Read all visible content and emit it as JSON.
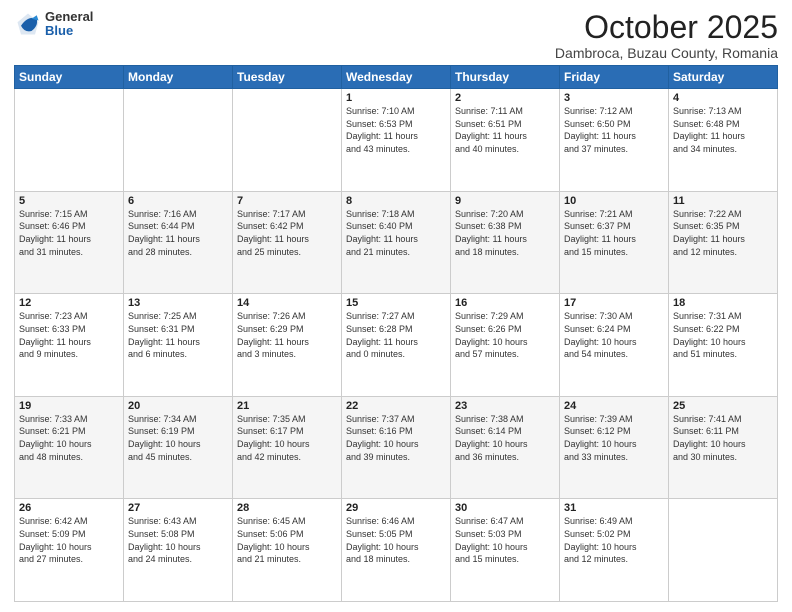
{
  "header": {
    "logo_general": "General",
    "logo_blue": "Blue",
    "title": "October 2025",
    "location": "Dambroca, Buzau County, Romania"
  },
  "weekdays": [
    "Sunday",
    "Monday",
    "Tuesday",
    "Wednesday",
    "Thursday",
    "Friday",
    "Saturday"
  ],
  "weeks": [
    [
      {
        "day": "",
        "info": ""
      },
      {
        "day": "",
        "info": ""
      },
      {
        "day": "",
        "info": ""
      },
      {
        "day": "1",
        "info": "Sunrise: 7:10 AM\nSunset: 6:53 PM\nDaylight: 11 hours\nand 43 minutes."
      },
      {
        "day": "2",
        "info": "Sunrise: 7:11 AM\nSunset: 6:51 PM\nDaylight: 11 hours\nand 40 minutes."
      },
      {
        "day": "3",
        "info": "Sunrise: 7:12 AM\nSunset: 6:50 PM\nDaylight: 11 hours\nand 37 minutes."
      },
      {
        "day": "4",
        "info": "Sunrise: 7:13 AM\nSunset: 6:48 PM\nDaylight: 11 hours\nand 34 minutes."
      }
    ],
    [
      {
        "day": "5",
        "info": "Sunrise: 7:15 AM\nSunset: 6:46 PM\nDaylight: 11 hours\nand 31 minutes."
      },
      {
        "day": "6",
        "info": "Sunrise: 7:16 AM\nSunset: 6:44 PM\nDaylight: 11 hours\nand 28 minutes."
      },
      {
        "day": "7",
        "info": "Sunrise: 7:17 AM\nSunset: 6:42 PM\nDaylight: 11 hours\nand 25 minutes."
      },
      {
        "day": "8",
        "info": "Sunrise: 7:18 AM\nSunset: 6:40 PM\nDaylight: 11 hours\nand 21 minutes."
      },
      {
        "day": "9",
        "info": "Sunrise: 7:20 AM\nSunset: 6:38 PM\nDaylight: 11 hours\nand 18 minutes."
      },
      {
        "day": "10",
        "info": "Sunrise: 7:21 AM\nSunset: 6:37 PM\nDaylight: 11 hours\nand 15 minutes."
      },
      {
        "day": "11",
        "info": "Sunrise: 7:22 AM\nSunset: 6:35 PM\nDaylight: 11 hours\nand 12 minutes."
      }
    ],
    [
      {
        "day": "12",
        "info": "Sunrise: 7:23 AM\nSunset: 6:33 PM\nDaylight: 11 hours\nand 9 minutes."
      },
      {
        "day": "13",
        "info": "Sunrise: 7:25 AM\nSunset: 6:31 PM\nDaylight: 11 hours\nand 6 minutes."
      },
      {
        "day": "14",
        "info": "Sunrise: 7:26 AM\nSunset: 6:29 PM\nDaylight: 11 hours\nand 3 minutes."
      },
      {
        "day": "15",
        "info": "Sunrise: 7:27 AM\nSunset: 6:28 PM\nDaylight: 11 hours\nand 0 minutes."
      },
      {
        "day": "16",
        "info": "Sunrise: 7:29 AM\nSunset: 6:26 PM\nDaylight: 10 hours\nand 57 minutes."
      },
      {
        "day": "17",
        "info": "Sunrise: 7:30 AM\nSunset: 6:24 PM\nDaylight: 10 hours\nand 54 minutes."
      },
      {
        "day": "18",
        "info": "Sunrise: 7:31 AM\nSunset: 6:22 PM\nDaylight: 10 hours\nand 51 minutes."
      }
    ],
    [
      {
        "day": "19",
        "info": "Sunrise: 7:33 AM\nSunset: 6:21 PM\nDaylight: 10 hours\nand 48 minutes."
      },
      {
        "day": "20",
        "info": "Sunrise: 7:34 AM\nSunset: 6:19 PM\nDaylight: 10 hours\nand 45 minutes."
      },
      {
        "day": "21",
        "info": "Sunrise: 7:35 AM\nSunset: 6:17 PM\nDaylight: 10 hours\nand 42 minutes."
      },
      {
        "day": "22",
        "info": "Sunrise: 7:37 AM\nSunset: 6:16 PM\nDaylight: 10 hours\nand 39 minutes."
      },
      {
        "day": "23",
        "info": "Sunrise: 7:38 AM\nSunset: 6:14 PM\nDaylight: 10 hours\nand 36 minutes."
      },
      {
        "day": "24",
        "info": "Sunrise: 7:39 AM\nSunset: 6:12 PM\nDaylight: 10 hours\nand 33 minutes."
      },
      {
        "day": "25",
        "info": "Sunrise: 7:41 AM\nSunset: 6:11 PM\nDaylight: 10 hours\nand 30 minutes."
      }
    ],
    [
      {
        "day": "26",
        "info": "Sunrise: 6:42 AM\nSunset: 5:09 PM\nDaylight: 10 hours\nand 27 minutes."
      },
      {
        "day": "27",
        "info": "Sunrise: 6:43 AM\nSunset: 5:08 PM\nDaylight: 10 hours\nand 24 minutes."
      },
      {
        "day": "28",
        "info": "Sunrise: 6:45 AM\nSunset: 5:06 PM\nDaylight: 10 hours\nand 21 minutes."
      },
      {
        "day": "29",
        "info": "Sunrise: 6:46 AM\nSunset: 5:05 PM\nDaylight: 10 hours\nand 18 minutes."
      },
      {
        "day": "30",
        "info": "Sunrise: 6:47 AM\nSunset: 5:03 PM\nDaylight: 10 hours\nand 15 minutes."
      },
      {
        "day": "31",
        "info": "Sunrise: 6:49 AM\nSunset: 5:02 PM\nDaylight: 10 hours\nand 12 minutes."
      },
      {
        "day": "",
        "info": ""
      }
    ]
  ]
}
